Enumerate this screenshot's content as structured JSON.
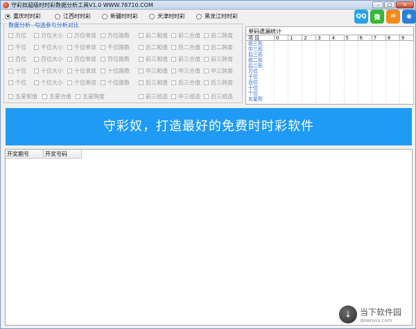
{
  "window": {
    "title": "守彩奴超级时时彩数据分析工具V1.0   WWW.78710.COM",
    "minimize": "–",
    "maximize": "□",
    "close": "✕"
  },
  "lottery": [
    {
      "label": "重庆时时彩",
      "selected": true
    },
    {
      "label": "江西时时彩",
      "selected": false
    },
    {
      "label": "新疆时时彩",
      "selected": false
    },
    {
      "label": "天津时时彩",
      "selected": false
    },
    {
      "label": "黑龙江时时彩",
      "selected": false
    }
  ],
  "social": {
    "qq": "QQ",
    "wechat": "微",
    "mail": "✉",
    "chat": "◉",
    "colors": {
      "qq": "#27a3e6",
      "wechat": "#35b834",
      "mail": "#f28a1a",
      "chat": "#2a7fd6"
    }
  },
  "analysis": {
    "legend": "数据分析--勾选参与分析对比",
    "left": [
      [
        "万位",
        "万位大小",
        "万位单双",
        "万位路数"
      ],
      [
        "千位",
        "千位大小",
        "千位单双",
        "千位路数"
      ],
      [
        "百位",
        "百位大小",
        "百位单双",
        "百位路数"
      ],
      [
        "十位",
        "十位大小",
        "十位单双",
        "十位路数"
      ],
      [
        "个位",
        "个位大小",
        "个位单双",
        "个位路数"
      ],
      [
        "五星和值",
        "五星合值",
        "五星跨度"
      ]
    ],
    "right": [
      [
        "前二和值",
        "前二合值",
        "前二跨度"
      ],
      [
        "后二和值",
        "后二合值",
        "后二跨度"
      ],
      [
        "前三和值",
        "前三合值",
        "前三跨度"
      ],
      [
        "中三和值",
        "中三合值",
        "中三跨度"
      ],
      [
        "后三和值",
        "后三合值",
        "后三跨度"
      ],
      [
        "前三组选",
        "中三组选",
        "后三组选"
      ]
    ]
  },
  "stats": {
    "title": "单码遗漏统计",
    "header": "项 目",
    "digits": [
      "0",
      "1",
      "2",
      "3",
      "4",
      "5",
      "6",
      "7",
      "8",
      "9"
    ],
    "rows": [
      "前三形",
      "中三形",
      "后三形",
      "前二形",
      "后二形",
      "万位",
      "千位",
      "百位",
      "十位",
      "个位",
      "五星形"
    ]
  },
  "banner": {
    "text": "守彩奴，打造最好的免费时时彩软件",
    "color": "#1f9bf5"
  },
  "results": {
    "columns": [
      "开奖期号",
      "开奖号码"
    ]
  },
  "watermark": {
    "name": "当下软件园",
    "url": "downxia.com"
  }
}
